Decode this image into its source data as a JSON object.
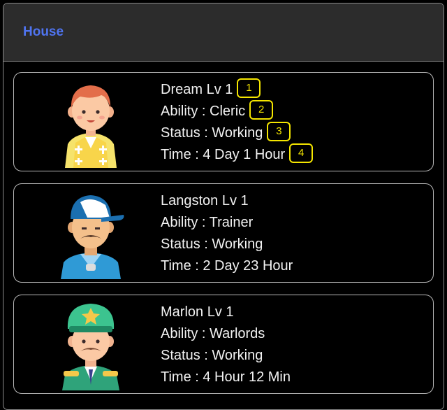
{
  "header": {
    "title": "House"
  },
  "characters": [
    {
      "name_line": "Dream Lv 1",
      "ability_line": "Ability : Cleric",
      "status_line": "Status : Working",
      "time_line": "Time : 4 Day 1 Hour",
      "avatar_icon": "priest-avatar-icon"
    },
    {
      "name_line": "Langston Lv 1",
      "ability_line": "Ability : Trainer",
      "status_line": "Status : Working",
      "time_line": "Time : 2 Day 23 Hour",
      "avatar_icon": "coach-avatar-icon"
    },
    {
      "name_line": "Marlon Lv 1",
      "ability_line": "Ability : Warlords",
      "status_line": "Status : Working",
      "time_line": "Time : 4 Hour 12 Min",
      "avatar_icon": "general-avatar-icon"
    }
  ],
  "markers": [
    "1",
    "2",
    "3",
    "4"
  ],
  "colors": {
    "accent": "#4f74f0",
    "marker": "#f5e600",
    "header_bg": "#2c2c2c"
  }
}
